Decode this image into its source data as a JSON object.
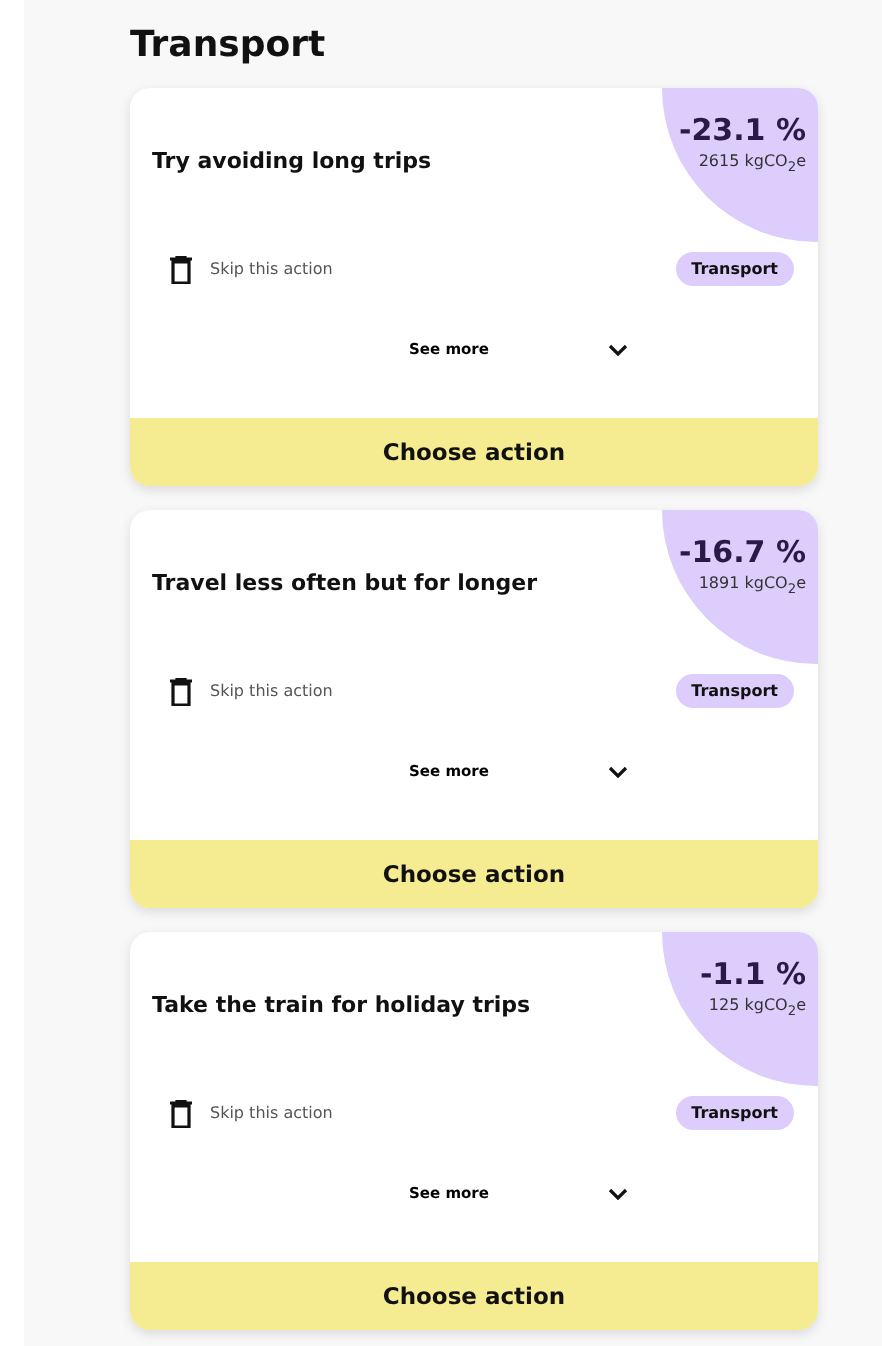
{
  "heading": "Transport",
  "actions": [
    {
      "title": "Try avoiding long trips",
      "percent": "-23.1 %",
      "amount": "2615 kgCO$_{2}$e",
      "skip": "Skip this action",
      "tag": "Transport",
      "see_more": "See more",
      "expanded": false,
      "button": "Choose action"
    },
    {
      "title": "Travel less often but for longer",
      "percent": "-16.7 %",
      "amount": "1891 kgCO$_{2}$e",
      "skip": "Skip this action",
      "tag": "Transport",
      "see_more": "See more",
      "expanded": false,
      "button": "Choose action"
    },
    {
      "title": "Take the train for holiday trips",
      "percent": "-1.1 %",
      "amount": "125 kgCO$_{2}$e",
      "skip": "Skip this action",
      "tag": "Transport",
      "see_more": "See more",
      "expanded": false,
      "button": "Choose action"
    }
  ]
}
